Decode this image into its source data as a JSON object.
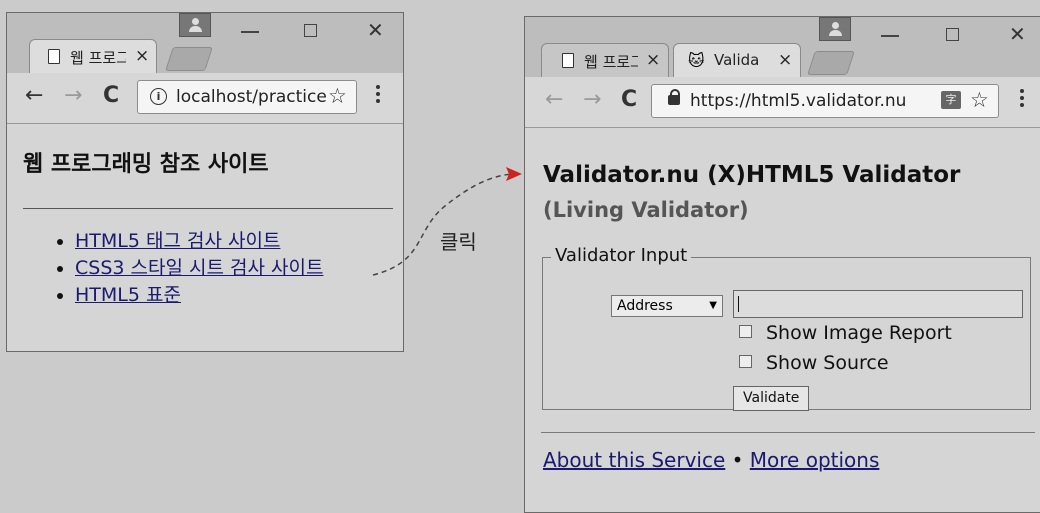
{
  "left_window": {
    "tab": {
      "title": "웹 프로그",
      "close": "×"
    },
    "toolbar": {
      "back": "←",
      "forward": "→",
      "reload": "C",
      "url": "localhost/practice",
      "star": "☆"
    },
    "page": {
      "title": "웹 프로그래밍 참조 사이트",
      "links": [
        "HTML5 태그 검사 사이트",
        "CSS3 스타일 시트 검사 사이트",
        "HTML5 표준"
      ]
    }
  },
  "annotation": {
    "label": "클릭",
    "arrow_color": "#cc2222"
  },
  "right_window": {
    "tabs": [
      {
        "title": "웹 프로그",
        "close": "×"
      },
      {
        "title": "Valida",
        "close": "×"
      }
    ],
    "toolbar": {
      "back": "←",
      "forward": "→",
      "reload": "C",
      "url": "https://html5.validator.nu",
      "translate": "字",
      "star": "☆"
    },
    "page": {
      "heading": "Validator.nu (X)HTML5 Validator",
      "subheading": "(Living Validator)",
      "fieldset_legend": "Validator Input",
      "select_value": "Address",
      "select_arrow": "▼",
      "input_value": "",
      "checkbox_image_report": "Show Image Report",
      "checkbox_source": "Show Source",
      "validate_button": "Validate",
      "footer_link_about": "About this Service",
      "footer_separator": "•",
      "footer_link_more": "More options"
    }
  }
}
